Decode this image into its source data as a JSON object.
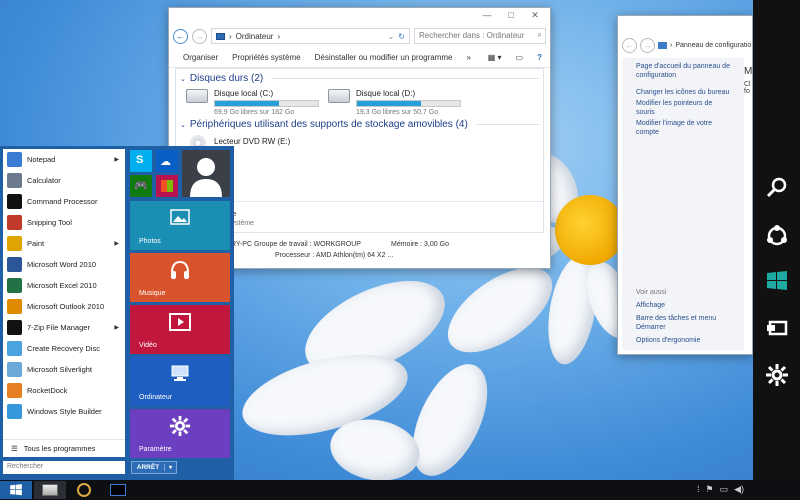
{
  "explorer": {
    "address": "Ordinateur",
    "search_placeholder": "Rechercher dans : Ordinateur",
    "toolbar": [
      "Organiser",
      "Propriétés système",
      "Désinstaller ou modifier un programme"
    ],
    "toolbar_more": "»",
    "groups": {
      "hard_disks": "Disques durs (2)",
      "removable": "Périphériques utilisant des supports de stockage amovibles (4)"
    },
    "drives": [
      {
        "name": "Disque local (C:)",
        "free": "69,9 Go libres sur 182 Go",
        "used_fraction": 0.62
      },
      {
        "name": "Disque local (D:)",
        "free": "19,3 Go libres sur 50,7 Go",
        "used_fraction": 0.62
      }
    ],
    "dvd": "Lecteur DVD RW (E:)",
    "partial_labels": [
      "ille",
      "système"
    ],
    "status": {
      "workgroup": "RY-PC  Groupe de travail : WORKGROUP",
      "memory": "Mémoire : 3,00 Go",
      "processor": "Processeur : AMD Athlon(tm) 64 X2 ..."
    }
  },
  "cpanel": {
    "address": "Panneau de configuratio",
    "links": [
      "Page d'accueil du panneau de configuration",
      "Changer les icônes du bureau",
      "Modifier les pointeurs de souris",
      "Modifier l'image de votre compte"
    ],
    "see_also": "Voir aussi",
    "see_also_links": [
      "Affichage",
      "Barre des tâches et menu Démarrer",
      "Options d'ergonomie"
    ],
    "right_partial": [
      "M",
      "Cl",
      "fo"
    ]
  },
  "start_menu": {
    "items": [
      {
        "label": "Notepad",
        "arrow": true,
        "icon": "notepad-icon",
        "color": "#3a7bd5"
      },
      {
        "label": "Calculator",
        "arrow": false,
        "icon": "calculator-icon",
        "color": "#6b7a8c"
      },
      {
        "label": "Command Processor",
        "arrow": false,
        "icon": "cmd-icon",
        "color": "#111111"
      },
      {
        "label": "Snipping Tool",
        "arrow": false,
        "icon": "scissors-icon",
        "color": "#c0392b"
      },
      {
        "label": "Paint",
        "arrow": true,
        "icon": "paint-icon",
        "color": "#e0a400"
      },
      {
        "label": "Microsoft Word 2010",
        "arrow": false,
        "icon": "word-icon",
        "color": "#2b579a"
      },
      {
        "label": "Microsoft Excel 2010",
        "arrow": false,
        "icon": "excel-icon",
        "color": "#217346"
      },
      {
        "label": "Microsoft Outlook 2010",
        "arrow": false,
        "icon": "outlook-icon",
        "color": "#e08a00"
      },
      {
        "label": "7-Zip File Manager",
        "arrow": true,
        "icon": "7zip-icon",
        "color": "#111111"
      },
      {
        "label": "Create Recovery Disc",
        "arrow": false,
        "icon": "disc-icon",
        "color": "#4aa3df"
      },
      {
        "label": "Microsoft Silverlight",
        "arrow": false,
        "icon": "silverlight-icon",
        "color": "#6aa8d8"
      },
      {
        "label": "RocketDock",
        "arrow": false,
        "icon": "rocketdock-icon",
        "color": "#e67e22"
      },
      {
        "label": "Windows Style Builder",
        "arrow": false,
        "icon": "style-builder-icon",
        "color": "#3498db"
      }
    ],
    "all_programs": "Tous les programmes",
    "search_placeholder": "Rechercher",
    "power": "ARRÊT",
    "tiles": {
      "photos": "Photos",
      "musique": "Musique",
      "video": "Vidéo",
      "ordinateur": "Ordinateur",
      "parametre": "Paramètre"
    }
  },
  "charms": [
    "search-icon",
    "share-icon",
    "start-icon",
    "devices-icon",
    "settings-icon"
  ],
  "colors": {
    "tile_photos": "#1b8fb3",
    "tile_musique": "#d9532c",
    "tile_video": "#c1173d",
    "tile_ordinateur": "#1e5ec0",
    "tile_parametre": "#6c3fc0"
  }
}
